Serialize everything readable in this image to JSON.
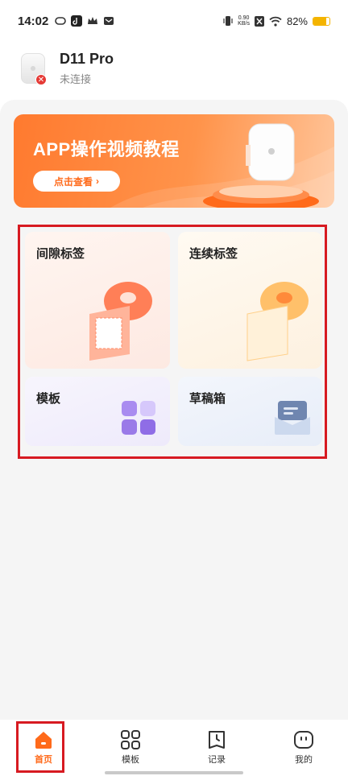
{
  "status_bar": {
    "time": "14:02",
    "speed_value": "0.90",
    "speed_unit": "KB/s",
    "battery": "82%",
    "battery_level": 0.82
  },
  "device": {
    "name": "D11 Pro",
    "status": "未连接"
  },
  "banner": {
    "title": "APP操作视频教程",
    "button": "点击查看"
  },
  "features": {
    "gap_label": "间隙标签",
    "continuous_label": "连续标签",
    "template": "模板",
    "drafts": "草稿箱"
  },
  "nav": {
    "home": "首页",
    "template": "模板",
    "record": "记录",
    "mine": "我的"
  },
  "colors": {
    "accent": "#ff6a1a",
    "highlight_frame": "#d71a21"
  }
}
